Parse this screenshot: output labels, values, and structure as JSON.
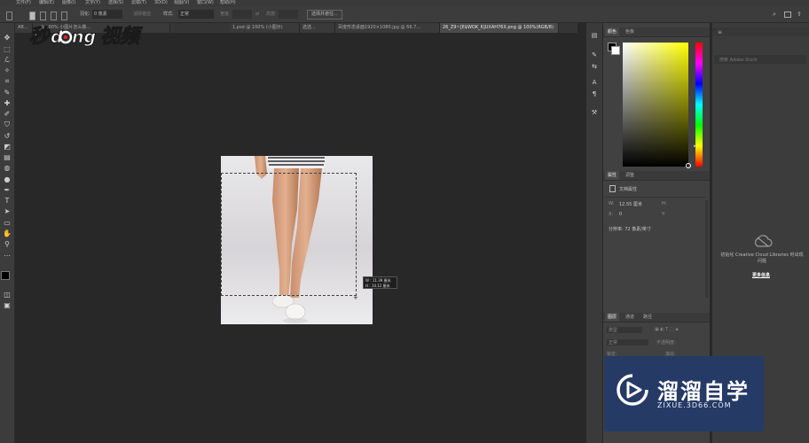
{
  "menubar": {
    "items": [
      "文件(F)",
      "编辑(E)",
      "图像(I)",
      "文字(Y)",
      "选择(S)",
      "滤镜(T)",
      "3D(D)",
      "视图(V)",
      "窗口(W)",
      "帮助(H)"
    ]
  },
  "options": {
    "feather_label": "羽化:",
    "feather_value": "0 像素",
    "antialias_label": "消除锯齿",
    "style_label": "样式:",
    "style_value": "正常",
    "width_label": "宽度:",
    "height_label": "高度:",
    "select_mask_button": "选择并遮住..."
  },
  "tabs": [
    {
      "label": "AB..."
    },
    {
      "label": "...@ 100% 小图片怎么做..."
    },
    {
      "label": "1.psd @ 100% (小图示)"
    },
    {
      "label": "选选..."
    },
    {
      "label": "百度形态桌面1920×1080.jpg @ 66.7..."
    },
    {
      "label": "26_Z9~[E$WOK_6]UXAH76X.png @ 100%(RGB/8)"
    }
  ],
  "watermark": {
    "text": "秒懂视频"
  },
  "tooltip": {
    "w_line": "W : 11.39 厘米",
    "h_line": "H : 10.12 厘米"
  },
  "color_panel": {
    "tabs": [
      "颜色",
      "色板"
    ],
    "active": "颜色"
  },
  "properties_panel": {
    "tabs": [
      "属性",
      "调整"
    ],
    "doc_label": "文档属性",
    "w_label": "W:",
    "w_value": "12.55 厘米",
    "h_label": "H:",
    "x_label": "X:",
    "x_value": "0",
    "y_label": "Y:",
    "resolution": "分辨率: 72 像素/英寸"
  },
  "layers_panel": {
    "tabs": [
      "图层",
      "通道",
      "路径"
    ],
    "kind_label": "类型",
    "mode_label": "正常",
    "opacity_label": "不透明度:",
    "lock_label": "锁定:",
    "fill_label": "填充:"
  },
  "cc_panel": {
    "search_placeholder": "搜索 Adobe Stock",
    "message": "初始化 Creative Cloud Libraries 时出现问题",
    "more_info": "更多信息"
  },
  "brand": {
    "title": "溜溜自学",
    "url": "ZIXUE.3D66.COM"
  },
  "colors": {
    "accent_red": "#e8202a",
    "hue_gradient": [
      "#ff0000",
      "#ff00ff",
      "#0000ff",
      "#00ffff",
      "#00ff00",
      "#ffff00",
      "#ff0000"
    ],
    "picker_base": "#ffff00",
    "brand_bg": "#263a66"
  }
}
